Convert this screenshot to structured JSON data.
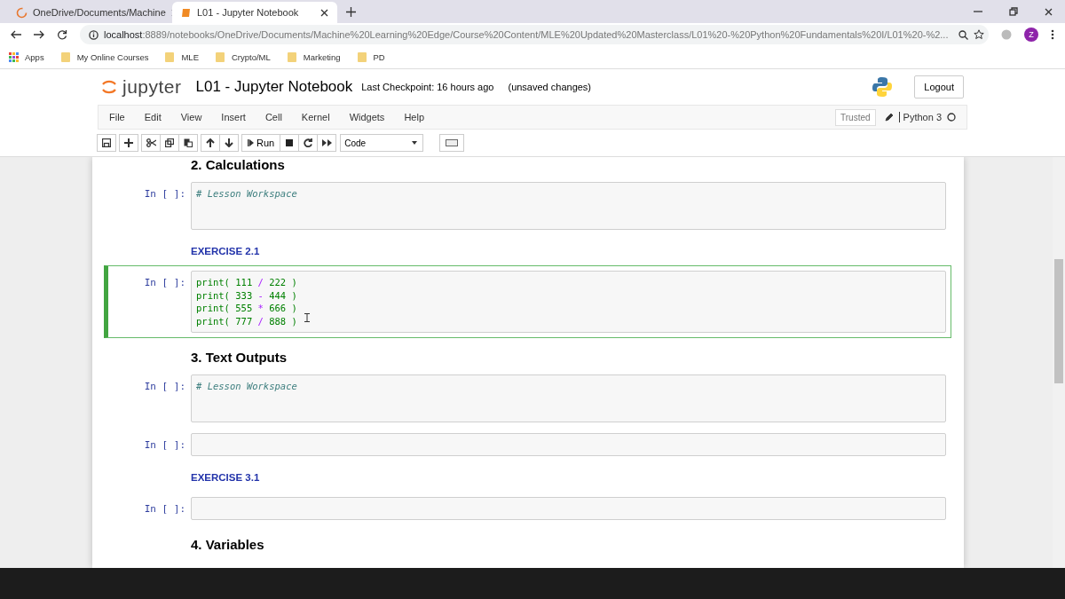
{
  "browser": {
    "tabs": [
      {
        "title": "OneDrive/Documents/Machine",
        "kind": "spinner",
        "selected": false
      },
      {
        "title": "L01 - Jupyter Notebook",
        "kind": "notebook",
        "selected": true
      }
    ],
    "address": {
      "host": "localhost",
      "path": ":8889/notebooks/OneDrive/Documents/Machine%20Learning%20Edge/Course%20Content/MLE%20Updated%20Masterclass/L01%20-%20Python%20Fundamentals%20I/L01%20-%2..."
    },
    "profile": "Z",
    "bookmarks": [
      {
        "label": "Apps",
        "kind": "apps"
      },
      {
        "label": "My Online Courses",
        "kind": "folder"
      },
      {
        "label": "MLE",
        "kind": "folder"
      },
      {
        "label": "Crypto/ML",
        "kind": "folder"
      },
      {
        "label": "Marketing",
        "kind": "folder"
      },
      {
        "label": "PD",
        "kind": "folder"
      }
    ]
  },
  "jupyter": {
    "logo": "jupyter",
    "notebook_name": "L01 - Jupyter Notebook",
    "checkpoint": "Last Checkpoint: 16 hours ago",
    "autosave_status": "(unsaved changes)",
    "logout": "Logout",
    "menus": [
      "File",
      "Edit",
      "View",
      "Insert",
      "Cell",
      "Kernel",
      "Widgets",
      "Help"
    ],
    "trusted": "Trusted",
    "kernel": "Python 3",
    "run": "Run",
    "cell_type": "Code"
  },
  "cells": [
    {
      "kind": "heading",
      "text": "2. Calculations"
    },
    {
      "kind": "code",
      "prompt": "In [ ]:",
      "selected": false,
      "lines": [
        "# Lesson Workspace"
      ]
    },
    {
      "kind": "exercise",
      "text": "EXERCISE 2.1"
    },
    {
      "kind": "code",
      "prompt": "In [ ]:",
      "selected": true,
      "lines": [
        "print( 111 / 222 )",
        "print( 333 - 444 )",
        "print( 555 * 666 )",
        "print( 777 / 888 )"
      ]
    },
    {
      "kind": "heading",
      "text": "3. Text Outputs"
    },
    {
      "kind": "code",
      "prompt": "In [ ]:",
      "selected": false,
      "lines": [
        "# Lesson Workspace"
      ]
    },
    {
      "kind": "code",
      "prompt": "In [ ]:",
      "selected": false
    },
    {
      "kind": "exercise",
      "text": "EXERCISE 3.1"
    },
    {
      "kind": "code",
      "prompt": "In [ ]:",
      "selected": false
    },
    {
      "kind": "heading",
      "text": "4. Variables"
    }
  ]
}
